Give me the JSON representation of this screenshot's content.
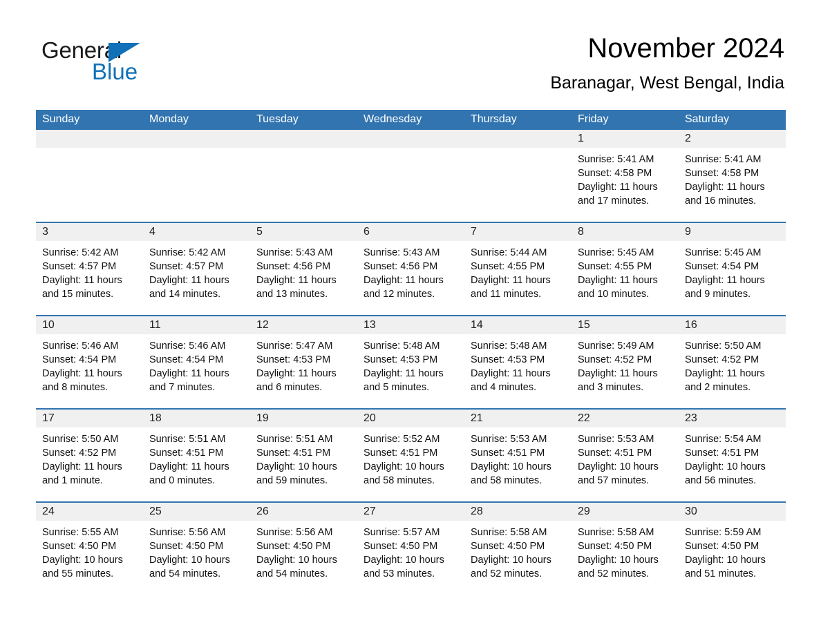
{
  "brand": {
    "line1": "General",
    "line2": "Blue",
    "accent_color": "#1070b8"
  },
  "header": {
    "title": "November 2024",
    "subtitle": "Baranagar, West Bengal, India"
  },
  "colors": {
    "header_blue": "#3174B0",
    "daynum_band": "#F0F0F0",
    "row_separator": "#3174B0",
    "text": "#111111"
  },
  "weekday_headers": [
    "Sunday",
    "Monday",
    "Tuesday",
    "Wednesday",
    "Thursday",
    "Friday",
    "Saturday"
  ],
  "weeks": [
    [
      {
        "day": "",
        "sunrise": "",
        "sunset": "",
        "daylight": ""
      },
      {
        "day": "",
        "sunrise": "",
        "sunset": "",
        "daylight": ""
      },
      {
        "day": "",
        "sunrise": "",
        "sunset": "",
        "daylight": ""
      },
      {
        "day": "",
        "sunrise": "",
        "sunset": "",
        "daylight": ""
      },
      {
        "day": "",
        "sunrise": "",
        "sunset": "",
        "daylight": ""
      },
      {
        "day": "1",
        "sunrise": "Sunrise: 5:41 AM",
        "sunset": "Sunset: 4:58 PM",
        "daylight": "Daylight: 11 hours and 17 minutes."
      },
      {
        "day": "2",
        "sunrise": "Sunrise: 5:41 AM",
        "sunset": "Sunset: 4:58 PM",
        "daylight": "Daylight: 11 hours and 16 minutes."
      }
    ],
    [
      {
        "day": "3",
        "sunrise": "Sunrise: 5:42 AM",
        "sunset": "Sunset: 4:57 PM",
        "daylight": "Daylight: 11 hours and 15 minutes."
      },
      {
        "day": "4",
        "sunrise": "Sunrise: 5:42 AM",
        "sunset": "Sunset: 4:57 PM",
        "daylight": "Daylight: 11 hours and 14 minutes."
      },
      {
        "day": "5",
        "sunrise": "Sunrise: 5:43 AM",
        "sunset": "Sunset: 4:56 PM",
        "daylight": "Daylight: 11 hours and 13 minutes."
      },
      {
        "day": "6",
        "sunrise": "Sunrise: 5:43 AM",
        "sunset": "Sunset: 4:56 PM",
        "daylight": "Daylight: 11 hours and 12 minutes."
      },
      {
        "day": "7",
        "sunrise": "Sunrise: 5:44 AM",
        "sunset": "Sunset: 4:55 PM",
        "daylight": "Daylight: 11 hours and 11 minutes."
      },
      {
        "day": "8",
        "sunrise": "Sunrise: 5:45 AM",
        "sunset": "Sunset: 4:55 PM",
        "daylight": "Daylight: 11 hours and 10 minutes."
      },
      {
        "day": "9",
        "sunrise": "Sunrise: 5:45 AM",
        "sunset": "Sunset: 4:54 PM",
        "daylight": "Daylight: 11 hours and 9 minutes."
      }
    ],
    [
      {
        "day": "10",
        "sunrise": "Sunrise: 5:46 AM",
        "sunset": "Sunset: 4:54 PM",
        "daylight": "Daylight: 11 hours and 8 minutes."
      },
      {
        "day": "11",
        "sunrise": "Sunrise: 5:46 AM",
        "sunset": "Sunset: 4:54 PM",
        "daylight": "Daylight: 11 hours and 7 minutes."
      },
      {
        "day": "12",
        "sunrise": "Sunrise: 5:47 AM",
        "sunset": "Sunset: 4:53 PM",
        "daylight": "Daylight: 11 hours and 6 minutes."
      },
      {
        "day": "13",
        "sunrise": "Sunrise: 5:48 AM",
        "sunset": "Sunset: 4:53 PM",
        "daylight": "Daylight: 11 hours and 5 minutes."
      },
      {
        "day": "14",
        "sunrise": "Sunrise: 5:48 AM",
        "sunset": "Sunset: 4:53 PM",
        "daylight": "Daylight: 11 hours and 4 minutes."
      },
      {
        "day": "15",
        "sunrise": "Sunrise: 5:49 AM",
        "sunset": "Sunset: 4:52 PM",
        "daylight": "Daylight: 11 hours and 3 minutes."
      },
      {
        "day": "16",
        "sunrise": "Sunrise: 5:50 AM",
        "sunset": "Sunset: 4:52 PM",
        "daylight": "Daylight: 11 hours and 2 minutes."
      }
    ],
    [
      {
        "day": "17",
        "sunrise": "Sunrise: 5:50 AM",
        "sunset": "Sunset: 4:52 PM",
        "daylight": "Daylight: 11 hours and 1 minute."
      },
      {
        "day": "18",
        "sunrise": "Sunrise: 5:51 AM",
        "sunset": "Sunset: 4:51 PM",
        "daylight": "Daylight: 11 hours and 0 minutes."
      },
      {
        "day": "19",
        "sunrise": "Sunrise: 5:51 AM",
        "sunset": "Sunset: 4:51 PM",
        "daylight": "Daylight: 10 hours and 59 minutes."
      },
      {
        "day": "20",
        "sunrise": "Sunrise: 5:52 AM",
        "sunset": "Sunset: 4:51 PM",
        "daylight": "Daylight: 10 hours and 58 minutes."
      },
      {
        "day": "21",
        "sunrise": "Sunrise: 5:53 AM",
        "sunset": "Sunset: 4:51 PM",
        "daylight": "Daylight: 10 hours and 58 minutes."
      },
      {
        "day": "22",
        "sunrise": "Sunrise: 5:53 AM",
        "sunset": "Sunset: 4:51 PM",
        "daylight": "Daylight: 10 hours and 57 minutes."
      },
      {
        "day": "23",
        "sunrise": "Sunrise: 5:54 AM",
        "sunset": "Sunset: 4:51 PM",
        "daylight": "Daylight: 10 hours and 56 minutes."
      }
    ],
    [
      {
        "day": "24",
        "sunrise": "Sunrise: 5:55 AM",
        "sunset": "Sunset: 4:50 PM",
        "daylight": "Daylight: 10 hours and 55 minutes."
      },
      {
        "day": "25",
        "sunrise": "Sunrise: 5:56 AM",
        "sunset": "Sunset: 4:50 PM",
        "daylight": "Daylight: 10 hours and 54 minutes."
      },
      {
        "day": "26",
        "sunrise": "Sunrise: 5:56 AM",
        "sunset": "Sunset: 4:50 PM",
        "daylight": "Daylight: 10 hours and 54 minutes."
      },
      {
        "day": "27",
        "sunrise": "Sunrise: 5:57 AM",
        "sunset": "Sunset: 4:50 PM",
        "daylight": "Daylight: 10 hours and 53 minutes."
      },
      {
        "day": "28",
        "sunrise": "Sunrise: 5:58 AM",
        "sunset": "Sunset: 4:50 PM",
        "daylight": "Daylight: 10 hours and 52 minutes."
      },
      {
        "day": "29",
        "sunrise": "Sunrise: 5:58 AM",
        "sunset": "Sunset: 4:50 PM",
        "daylight": "Daylight: 10 hours and 52 minutes."
      },
      {
        "day": "30",
        "sunrise": "Sunrise: 5:59 AM",
        "sunset": "Sunset: 4:50 PM",
        "daylight": "Daylight: 10 hours and 51 minutes."
      }
    ]
  ]
}
